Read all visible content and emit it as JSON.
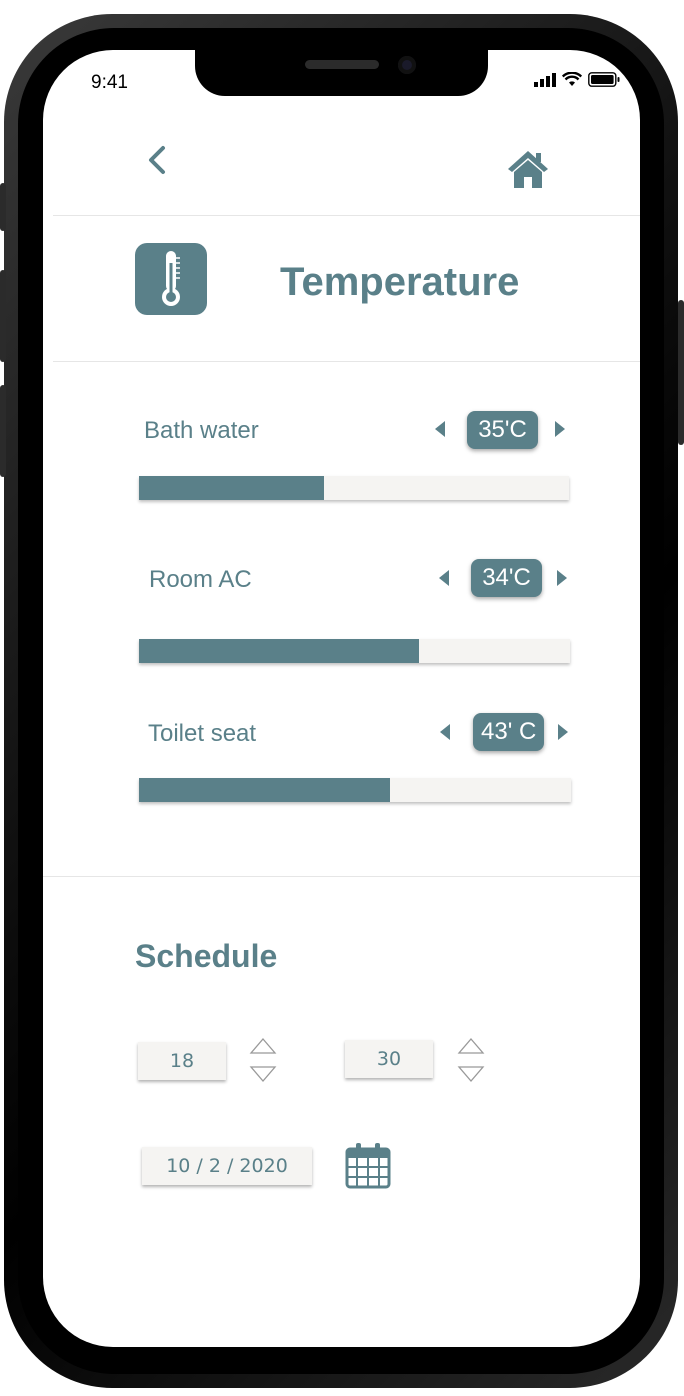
{
  "status_bar": {
    "time": "9:41"
  },
  "header": {
    "title": "Temperature"
  },
  "controls": [
    {
      "label": "Bath water",
      "value": "35'C",
      "level": 0.43
    },
    {
      "label": "Room AC",
      "value": "34'C",
      "level": 0.65
    },
    {
      "label": "Toilet seat",
      "value": "43' C",
      "level": 0.58
    }
  ],
  "schedule": {
    "title": "Schedule",
    "hour": "18",
    "minute": "30",
    "date": "10 / 2 / 2020"
  },
  "colors": {
    "accent": "#5a8089",
    "field_bg": "#f5f4f2"
  },
  "icons": [
    "back-chevron-icon",
    "home-icon",
    "thermometer-icon",
    "calendar-icon"
  ]
}
